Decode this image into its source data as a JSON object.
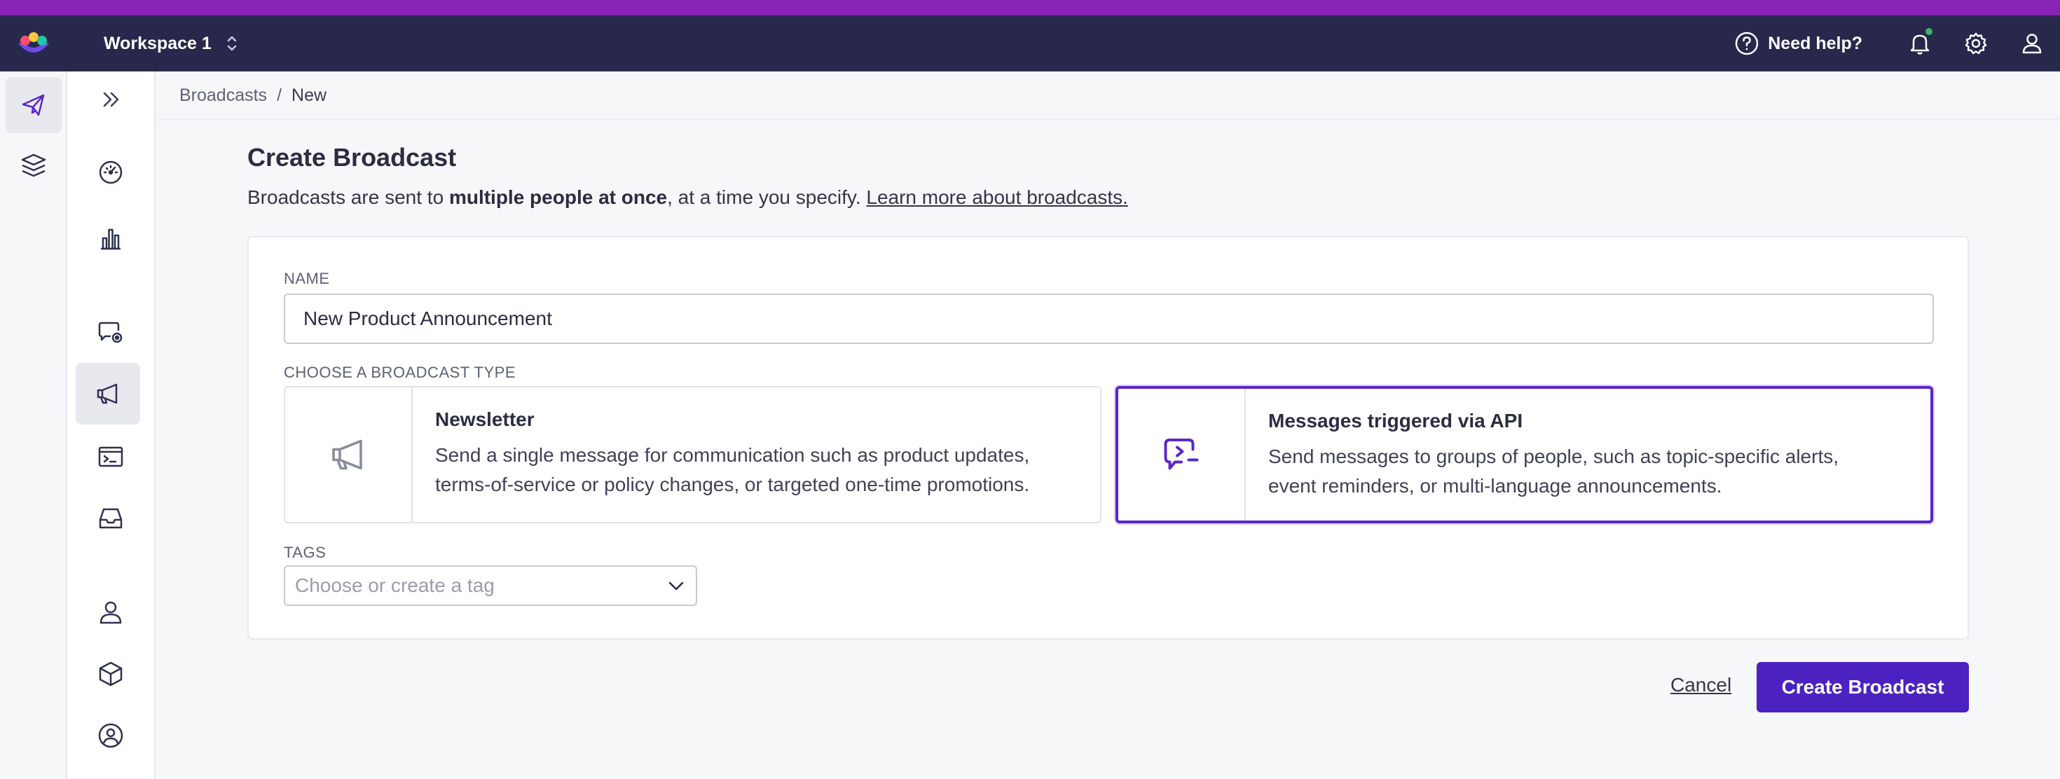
{
  "colors": {
    "accent_strip": "#8a24b8",
    "topbar": "#28284d",
    "primary": "#4b22c0",
    "selected_border": "#5a27c9",
    "notification_dot": "#3ab36a"
  },
  "topbar": {
    "workspace": "Workspace 1",
    "help_label": "Need help?",
    "icons": [
      "help-circle-icon",
      "bell-icon",
      "gear-icon",
      "user-icon"
    ]
  },
  "rail_primary": {
    "items": [
      {
        "icon": "paper-plane-icon",
        "active": true
      },
      {
        "icon": "layers-icon",
        "active": false
      }
    ]
  },
  "rail_secondary": {
    "items": [
      {
        "icon": "chevrons-right-icon"
      },
      {
        "icon": "gauge-icon"
      },
      {
        "icon": "bar-chart-icon"
      },
      {
        "icon": "chat-settings-icon"
      },
      {
        "icon": "megaphone-icon",
        "active": true
      },
      {
        "icon": "terminal-window-icon"
      },
      {
        "icon": "inbox-icon"
      },
      {
        "icon": "person-icon"
      },
      {
        "icon": "cube-icon"
      },
      {
        "icon": "user-circle-icon"
      }
    ]
  },
  "breadcrumb": {
    "root": "Broadcasts",
    "separator": "/",
    "current": "New"
  },
  "page": {
    "title": "Create Broadcast",
    "desc_prefix": "Broadcasts are sent to ",
    "desc_bold": "multiple people at once",
    "desc_suffix": ", at a time you specify. ",
    "learn_more": "Learn more about broadcasts."
  },
  "form": {
    "name_label": "NAME",
    "name_value": "New Product Announcement",
    "type_label": "CHOOSE A BROADCAST TYPE",
    "types": [
      {
        "icon": "megaphone-icon",
        "title": "Newsletter",
        "desc_line1": "Send a single message for communication such as product updates,",
        "desc_line2": "terms-of-service or policy changes, or targeted one-time promotions.",
        "selected": false
      },
      {
        "icon": "chat-terminal-icon",
        "title": "Messages triggered via API",
        "desc_line1": "Send messages to groups of people, such as topic-specific alerts,",
        "desc_line2": "event reminders, or multi-language announcements.",
        "selected": true
      }
    ],
    "tags_label": "TAGS",
    "tags_placeholder": "Choose or create a tag"
  },
  "actions": {
    "cancel": "Cancel",
    "create": "Create Broadcast"
  }
}
